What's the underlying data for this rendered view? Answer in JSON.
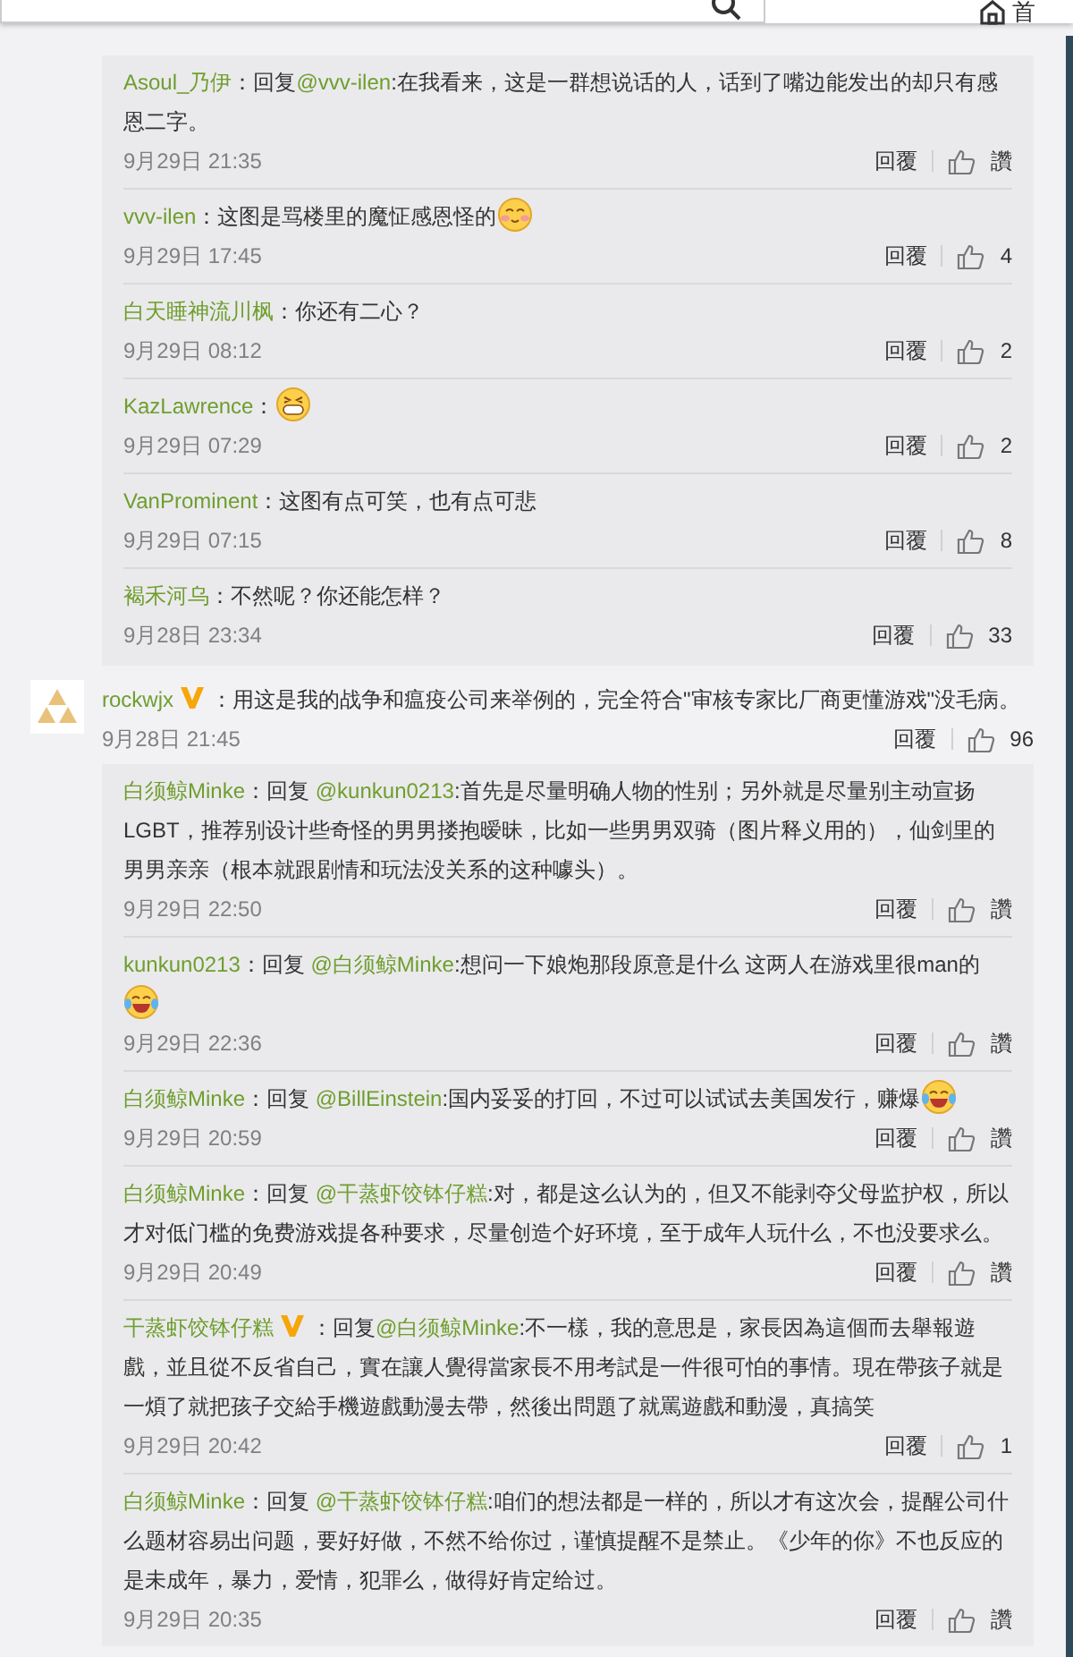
{
  "header": {
    "home_label": "首"
  },
  "reply_groups_top": [
    {
      "name": "Asoul_乃伊",
      "verified": false,
      "prefix": "：回复",
      "mention": "@vvv-ilen",
      "text": ":在我看来，这是一群想说话的人，话到了嘴边能发出的却只有感恩二字。",
      "time": "9月29日 21:35",
      "reply": "回覆",
      "likes": "讚"
    },
    {
      "name": "vvv-ilen",
      "verified": false,
      "text": "：这图是骂楼里的魔怔感恩怪的",
      "emoji": {
        "kind": "blush"
      },
      "time": "9月29日 17:45",
      "reply": "回覆",
      "likes": "4"
    },
    {
      "name": "白天睡神流川枫",
      "verified": false,
      "text": "：你还有二心？",
      "time": "9月29日 08:12",
      "reply": "回覆",
      "likes": "2"
    },
    {
      "name": "KazLawrence",
      "verified": false,
      "text": "：",
      "emoji": {
        "kind": "grin"
      },
      "time": "9月29日 07:29",
      "reply": "回覆",
      "likes": "2"
    },
    {
      "name": "VanProminent",
      "verified": false,
      "text": "：这图有点可笑，也有点可悲",
      "time": "9月29日 07:15",
      "reply": "回覆",
      "likes": "8"
    },
    {
      "name": "褐禾河乌",
      "verified": false,
      "text": "：不然呢？你还能怎样？",
      "time": "9月28日 23:34",
      "reply": "回覆",
      "likes": "33"
    }
  ],
  "comment": {
    "name": "rockwjx",
    "verified": true,
    "text": "：用这是我的战争和瘟疫公司来举例的，完全符合\"审核专家比厂商更懂游戏\"没毛病。",
    "time": "9月28日 21:45",
    "reply": "回覆",
    "likes": "96"
  },
  "replies": [
    {
      "name": "白须鲸Minke",
      "verified": false,
      "prefix": "：回复 ",
      "mention": "@kunkun0213",
      "text": ":首先是尽量明确人物的性别；另外就是尽量别主动宣扬LGBT，推荐别设计些奇怪的男男搂抱暧昧，比如一些男男双骑（图片释义用的），仙剑里的男男亲亲（根本就跟剧情和玩法没关系的这种噱头）。",
      "time": "9月29日 22:50",
      "reply": "回覆",
      "likes": "讚"
    },
    {
      "name": "kunkun0213",
      "verified": false,
      "prefix": "：回复 ",
      "mention": "@白须鲸Minke",
      "text": ":想问一下娘炮那段原意是什么  这两人在游戏里很man的",
      "emoji": {
        "kind": "tears"
      },
      "time": "9月29日 22:36",
      "reply": "回覆",
      "likes": "讚"
    },
    {
      "name": "白须鲸Minke",
      "verified": false,
      "prefix": "：回复 ",
      "mention": "@BillEinstein",
      "text": ":国内妥妥的打回，不过可以试试去美国发行，赚爆",
      "emoji": {
        "kind": "tears"
      },
      "time": "9月29日 20:59",
      "reply": "回覆",
      "likes": "讚"
    },
    {
      "name": "白须鲸Minke",
      "verified": false,
      "prefix": "：回复 ",
      "mention": "@干蒸虾饺钵仔糕",
      "text": ":对，都是这么认为的，但又不能剥夺父母监护权，所以才对低门槛的免费游戏提各种要求，尽量创造个好环境，至于成年人玩什么，不也没要求么。",
      "time": "9月29日 20:49",
      "reply": "回覆",
      "likes": "讚"
    },
    {
      "name": "干蒸虾饺钵仔糕",
      "verified": true,
      "prefix": "：回复",
      "mention": "@白须鲸Minke",
      "text": ":不一樣，我的意思是，家長因為這個而去舉報遊戲，並且從不反省自己，實在讓人覺得當家長不用考試是一件很可怕的事情。現在帶孩子就是一煩了就把孩子交給手機遊戲動漫去帶，然後出問題了就罵遊戲和動漫，真搞笑",
      "time": "9月29日 20:42",
      "reply": "回覆",
      "likes": "1"
    },
    {
      "name": "白须鲸Minke",
      "verified": false,
      "prefix": "：回复 ",
      "mention": "@干蒸虾饺钵仔糕",
      "text": ":咱们的想法都是一样的，所以才有这次会，提醒公司什么题材容易出问题，要好好做，不然不给你过，谨慎提醒不是禁止。《少年的你》不也反应的是未成年，暴力，爱情，犯罪么，做得好肯定给过。",
      "time": "9月29日 20:35",
      "reply": "回覆",
      "likes": "讚"
    }
  ]
}
